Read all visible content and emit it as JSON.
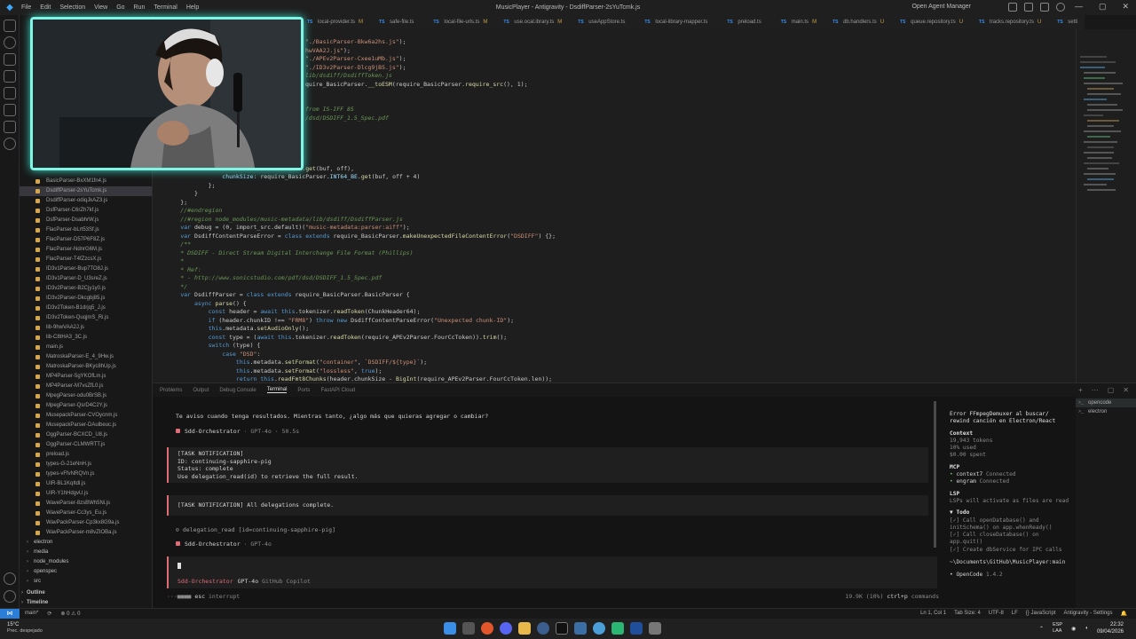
{
  "window": {
    "menu": [
      "File",
      "Edit",
      "Selection",
      "View",
      "Go",
      "Run",
      "Terminal",
      "Help"
    ],
    "title": "MusicPlayer - Antigravity - DsdiffParser-2sYuTcmk.js",
    "agent_manager": "Open Agent Manager",
    "controls": [
      "—",
      "▢",
      "✕"
    ]
  },
  "tabs": [
    {
      "label": "local-provider.ts",
      "mod": "M"
    },
    {
      "label": "safe-file.ts",
      "mod": ""
    },
    {
      "label": "local-file-urls.ts",
      "mod": "M"
    },
    {
      "label": "use.ocal.ibrary.ts",
      "mod": "M"
    },
    {
      "label": "useAppStore.ts",
      "mod": ""
    },
    {
      "label": "local-library-mapper.ts",
      "mod": ""
    },
    {
      "label": "preload.ts",
      "mod": ""
    },
    {
      "label": "main.ts",
      "mod": "M"
    },
    {
      "label": "db.handlers.ts",
      "mod": "U"
    },
    {
      "label": "queue.repository.ts",
      "mod": "U"
    },
    {
      "label": "tracks.repository.ts",
      "mod": "U"
    },
    {
      "label": "setti",
      "mod": ""
    }
  ],
  "sidebar": {
    "files": [
      "BasicParser-BxXM1fn4.js",
      "DsdiffParser-2sYuTcmk.js",
      "DsdiffParser-odiqJkAZ3.js",
      "DsfParser-C6rZh7kf.js",
      "DsfParser-DsabhrW.js",
      "FlacParser-bLrt53Sf.js",
      "FlacParser-D57P6F8Z.js",
      "FlacParser-NdnrG6M.js",
      "FlacParser-T4fZzcsX.js",
      "ID3v1Parser-Bup7TO8J.js",
      "ID3v1Parser-D_U3sreZ.js",
      "ID3v2Parser-B2Cjy1y0.js",
      "ID3v2Parser-Dkcgbj85.js",
      "ID3v2Token-B1drjq5_J.js",
      "ID3v2Token-QuqjmS_Ri.js",
      "lib-9hwVAA2J.js",
      "lib-C8tHA3_3C.js",
      "main.js",
      "MatroskaParser-E_4_9Hw.js",
      "MatroskaParser-BKyc8hUp.js",
      "MP4Parser-5gYKOfLm.js",
      "MP4Parser-M7vsZfL0.js",
      "MpegParser-odu0BrSB.js",
      "MpegParser-QsrD4C2Y.js",
      "MusepackParser-CVOycnm.js",
      "MusepackParser-DAulbeuc.js",
      "OggParser-BCXCD_U8.js",
      "OggParser-CLMWRTT.js",
      "preload.js",
      "types-G-21eNnH.js",
      "types-vFfvNRQVn.js",
      "UIR-BL1KqItdl.js",
      "UIR-Y1hHdgvU.js",
      "WaveParser-8zsBWh5Ni.js",
      "WaveParser-Cc3ys_Eu.js",
      "WavPackParser-Cp3kx8G9a.js",
      "WavPackParser-m8vZIOBa.js"
    ],
    "folders": [
      "electron",
      "media",
      "node_modules",
      "openspec",
      "src"
    ],
    "sections": [
      "Outline",
      "Timeline"
    ]
  },
  "editor": {
    "lines": [
      [
        [
          "st",
          "\"./BasicParser-Bkw6a2hs.js\""
        ],
        [
          "",
          ");"
        ]
      ],
      [
        [
          "st",
          "hwVAA2J.js\""
        ],
        [
          "",
          ");"
        ]
      ],
      [
        [
          "st",
          "\"./APEv2Parser-Cxee1uMb.js\""
        ],
        [
          "",
          ");"
        ]
      ],
      [
        [
          "st",
          "\"./ID3v2Parser-Dlcg9jB5.js\""
        ],
        [
          "",
          ");"
        ]
      ],
      [
        [
          "cm",
          "lib/dsdiff/DsdiffToken.js"
        ]
      ],
      [
        [
          "",
          "quire_BasicParser."
        ],
        [
          "fn",
          "__toESM"
        ],
        [
          "",
          "(require_BasicParser."
        ],
        [
          "fn",
          "require_src"
        ],
        [
          "",
          "(), 1);"
        ]
      ],
      [
        [
          "",
          ""
        ]
      ],
      [
        [
          "",
          ""
        ]
      ],
      [
        [
          "cm",
          "from IS-IFF 85"
        ]
      ],
      [
        [
          "cm",
          "/dsd/DSDIFF_1.5_Spec.pdf"
        ]
      ],
      [
        [
          "",
          ""
        ]
      ],
      [
        [
          "",
          ""
        ]
      ],
      [
        [
          "",
          ""
        ]
      ],
      [
        [
          "",
          ""
        ]
      ],
      [
        [
          "",
          ""
        ]
      ],
      [
        [
          "",
          "                           rser."
        ],
        [
          "pr",
          "FourCcToken"
        ],
        [
          "",
          "."
        ],
        [
          "fn",
          "get"
        ],
        [
          "",
          "(buf, off),"
        ]
      ],
      [
        [
          "",
          "                    "
        ],
        [
          "pr",
          "chunkSize"
        ],
        [
          "",
          ": require_BasicParser."
        ],
        [
          "pr",
          "INT64_BE"
        ],
        [
          "",
          "."
        ],
        [
          "fn",
          "get"
        ],
        [
          "",
          "(buf, off + 4)"
        ]
      ],
      [
        [
          "",
          "                };"
        ]
      ],
      [
        [
          "",
          "            }"
        ]
      ],
      [
        [
          "",
          "        };"
        ]
      ],
      [
        [
          "cm",
          "        //#endregion"
        ]
      ],
      [
        [
          "cm",
          "        //#region node_modules/music-metadata/lib/dsdiff/DsdiffParser.js"
        ]
      ],
      [
        [
          "",
          "        "
        ],
        [
          "kw",
          "var"
        ],
        [
          "",
          " debug = (0, import_src.default)("
        ],
        [
          "st",
          "\"music-metadata:parser:aiff\""
        ],
        [
          "",
          ");"
        ]
      ],
      [
        [
          "",
          "        "
        ],
        [
          "kw",
          "var"
        ],
        [
          "",
          " DsdiffContentParseError = "
        ],
        [
          "kw",
          "class extends"
        ],
        [
          "",
          " require_BasicParser."
        ],
        [
          "fn",
          "makeUnexpectedFileContentError"
        ],
        [
          "",
          "("
        ],
        [
          "st",
          "\"DSDIFF\""
        ],
        [
          "",
          ") {};"
        ]
      ],
      [
        [
          "cm",
          "        /**"
        ]
      ],
      [
        [
          "cm",
          "        * DSDIFF - Direct Stream Digital Interchange File Format (Phillips)"
        ]
      ],
      [
        [
          "cm",
          "        *"
        ]
      ],
      [
        [
          "cm",
          "        * Ref:"
        ]
      ],
      [
        [
          "cm",
          "        * - http://www.sonicstudio.com/pdf/dsd/DSDIFF_1.5_Spec.pdf"
        ]
      ],
      [
        [
          "cm",
          "        */"
        ]
      ],
      [
        [
          "",
          "        "
        ],
        [
          "kw",
          "var"
        ],
        [
          "",
          " DsdiffParser = "
        ],
        [
          "kw",
          "class extends"
        ],
        [
          "",
          " require_BasicParser.BasicParser {"
        ]
      ],
      [
        [
          "",
          "            "
        ],
        [
          "kw",
          "async"
        ],
        [
          "",
          " "
        ],
        [
          "fn",
          "parse"
        ],
        [
          "",
          "() {"
        ]
      ],
      [
        [
          "",
          "                "
        ],
        [
          "kw",
          "const"
        ],
        [
          "",
          " header = "
        ],
        [
          "kw",
          "await this"
        ],
        [
          "",
          ".tokenizer."
        ],
        [
          "fn",
          "readToken"
        ],
        [
          "",
          "(ChunkHeader64);"
        ]
      ],
      [
        [
          "",
          "                "
        ],
        [
          "kw",
          "if"
        ],
        [
          "",
          " (header.chunkID !== "
        ],
        [
          "st",
          "\"FRM8\""
        ],
        [
          "",
          ") "
        ],
        [
          "kw",
          "throw new"
        ],
        [
          "",
          " DsdiffContentParseError("
        ],
        [
          "st",
          "\"Unexpected chunk-ID\""
        ],
        [
          "",
          ");"
        ]
      ],
      [
        [
          "",
          "                "
        ],
        [
          "kw",
          "this"
        ],
        [
          "",
          ".metadata."
        ],
        [
          "fn",
          "setAudioOnly"
        ],
        [
          "",
          "();"
        ]
      ],
      [
        [
          "",
          "                "
        ],
        [
          "kw",
          "const"
        ],
        [
          "",
          " type = ("
        ],
        [
          "kw",
          "await this"
        ],
        [
          "",
          ".tokenizer."
        ],
        [
          "fn",
          "readToken"
        ],
        [
          "",
          "(require_APEv2Parser.FourCcToken))."
        ],
        [
          "fn",
          "trim"
        ],
        [
          "",
          "();"
        ]
      ],
      [
        [
          "",
          "                "
        ],
        [
          "kw",
          "switch"
        ],
        [
          "",
          " (type) {"
        ]
      ],
      [
        [
          "",
          "                    "
        ],
        [
          "kw",
          "case"
        ],
        [
          "",
          " "
        ],
        [
          "st",
          "\"DSD\""
        ],
        [
          "",
          ":"
        ]
      ],
      [
        [
          "",
          "                        "
        ],
        [
          "kw",
          "this"
        ],
        [
          "",
          ".metadata."
        ],
        [
          "fn",
          "setFormat"
        ],
        [
          "",
          "("
        ],
        [
          "st",
          "\"container\""
        ],
        [
          "",
          ", "
        ],
        [
          "st",
          "`DSDIFF/${type}`"
        ],
        [
          "",
          ");"
        ]
      ],
      [
        [
          "",
          "                        "
        ],
        [
          "kw",
          "this"
        ],
        [
          "",
          ".metadata."
        ],
        [
          "fn",
          "setFormat"
        ],
        [
          "",
          "("
        ],
        [
          "st",
          "\"lossless\""
        ],
        [
          "",
          ", "
        ],
        [
          "kw",
          "true"
        ],
        [
          "",
          ");"
        ]
      ],
      [
        [
          "",
          "                        "
        ],
        [
          "kw",
          "return this"
        ],
        [
          "",
          "."
        ],
        [
          "fn",
          "readFmt8Chunks"
        ],
        [
          "",
          "(header.chunkSize - "
        ],
        [
          "fn",
          "BigInt"
        ],
        [
          "",
          "(require_APEv2Parser.FourCcToken.len));"
        ]
      ]
    ]
  },
  "panel": {
    "tabs": [
      "Problems",
      "Output",
      "Debug Console",
      "Terminal",
      "Ports",
      "FastAPI Cloud"
    ],
    "active_tab": "Terminal",
    "actions": [
      "+",
      "⋯",
      "▢",
      "✕"
    ]
  },
  "terminal": {
    "intro": "Te aviso cuando tenga resultados. Mientras tanto, ¿algo más que quieras agregar o cambiar?",
    "orch1": {
      "name": "Sdd-Orchestrator",
      "meta": "· GPT-4o · 50.5s"
    },
    "notif1": "[TASK NOTIFICATION]\nID: continuing-sapphire-pig\nStatus: complete\nUse delegation_read(id) to retrieve the full result.",
    "notif2": "[TASK NOTIFICATION] All delegations complete.",
    "delegation": "⊙ delegation_read [id=continuing-sapphire-pig]",
    "orch2": {
      "name": "Sdd-Orchestrator",
      "meta": "· GPT-4o"
    },
    "input_model": {
      "agent": "Sdd-Orchestrator",
      "model": "GPT-4o",
      "provider": "GitHub Copilot"
    },
    "footer_left_prefix": "···■■■■",
    "footer_left_key": "esc",
    "footer_left_label": "interrupt",
    "footer_right_tokens": "19.9K (10%)",
    "footer_right_key": "ctrl+p",
    "footer_right_label": "commands"
  },
  "info": {
    "title": "Error FFmpegDemuxer al buscar/ rewind canción en Electron/React",
    "context_head": "Context",
    "context": [
      "19,943 tokens",
      "10% used",
      "$0.00 spent"
    ],
    "mcp_head": "MCP",
    "mcp": [
      {
        "name": "context7",
        "status": "Connected"
      },
      {
        "name": "engram",
        "status": "Connected"
      }
    ],
    "lsp_head": "LSP",
    "lsp_text": "LSPs will activate as files are read",
    "todo_head": "▼ Todo",
    "todos": [
      "[✓] Call openDatabase() and initSchema() on app.whenReady()",
      "[✓] Call closeDatabase() on app.quit()",
      "[✓] Create dbService for IPC calls"
    ],
    "path": "~\\Documents\\GitHub\\MusicPlayer:main",
    "version_label": "• OpenCode",
    "version": "1.4.2"
  },
  "termlist": [
    "opencode",
    "electron"
  ],
  "statusbar": {
    "remote": "⋈",
    "branch": "main*",
    "sync": "⟳",
    "problems": "⊗ 0 ⚠ 0",
    "right": [
      "Ln 1, Col 1",
      "Tab Size: 4",
      "UTF-8",
      "LF",
      "{} JavaScript",
      "Antigravity - Settings",
      "🔔"
    ]
  },
  "taskbar": {
    "temp": "15°C",
    "weather": "Prec. despejado",
    "lang": "ESP\nLAA",
    "time": "22:32",
    "date": "09/04/2026"
  },
  "colors": {
    "accent": "#2b7ed8",
    "webcam_border": "#7ff5e6",
    "orchestrator": "#e06c75",
    "connected": "#6ac174"
  }
}
